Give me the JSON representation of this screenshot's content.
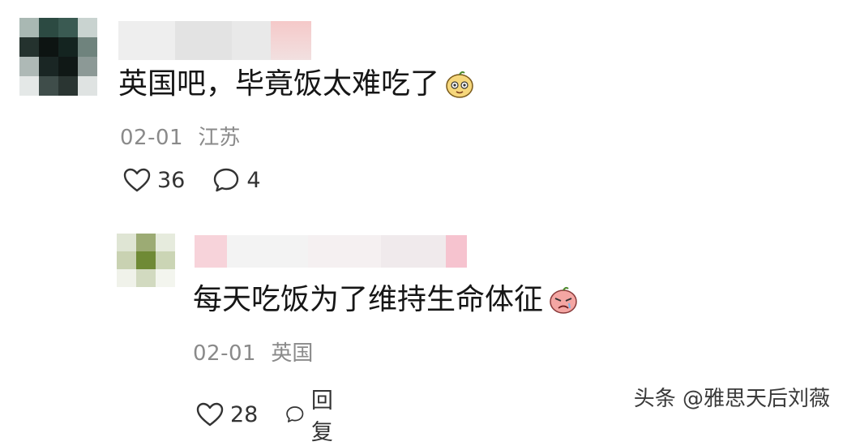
{
  "comments": [
    {
      "text": "英国吧，毕竟饭太难吃了",
      "date": "02-01",
      "location": "江苏",
      "likes": "36",
      "replies": "4",
      "emoji_icon": "cute-face-emoji-icon",
      "like_icon": "heart-outline-icon",
      "reply_icon": "speech-bubble-icon"
    },
    {
      "text": "每天吃饭为了维持生命体征",
      "date": "02-01",
      "location": "英国",
      "likes": "28",
      "reply_label": "回复",
      "emoji_icon": "sad-face-emoji-icon",
      "like_icon": "heart-outline-icon",
      "reply_icon": "speech-bubble-icon"
    }
  ],
  "watermark": "头条 @雅思天后刘薇",
  "colors": {
    "text": "#161616",
    "meta": "#8a8a8a",
    "icon": "#333333"
  }
}
